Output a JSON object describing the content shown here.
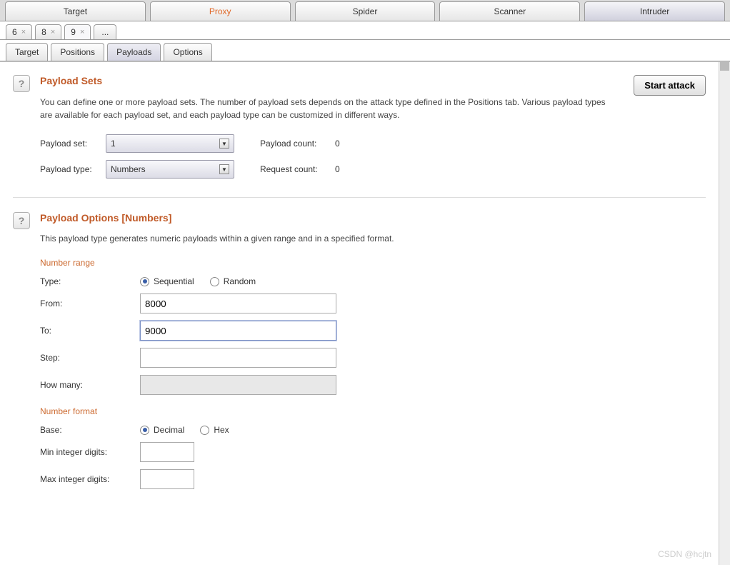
{
  "topTabs": {
    "target": "Target",
    "proxy": "Proxy",
    "spider": "Spider",
    "scanner": "Scanner",
    "intruder": "Intruder"
  },
  "numTabs": {
    "t6": "6",
    "t8": "8",
    "t9": "9",
    "ell": "..."
  },
  "subTabs": {
    "target": "Target",
    "positions": "Positions",
    "payloads": "Payloads",
    "options": "Options"
  },
  "startBtn": "Start attack",
  "payloadSets": {
    "title": "Payload Sets",
    "desc": "You can define one or more payload sets. The number of payload sets depends on the attack type defined in the Positions tab. Various payload types are available for each payload set, and each payload type can be customized in different ways.",
    "setLabel": "Payload set:",
    "setValue": "1",
    "typeLabel": "Payload type:",
    "typeValue": "Numbers",
    "countLabel": "Payload count:",
    "countValue": "0",
    "reqLabel": "Request count:",
    "reqValue": "0"
  },
  "payloadOptions": {
    "title": "Payload Options [Numbers]",
    "desc": "This payload type generates numeric payloads within a given range and in a specified format.",
    "rangeHead": "Number range",
    "typeLabel": "Type:",
    "seq": "Sequential",
    "rand": "Random",
    "fromLabel": "From:",
    "fromValue": "8000",
    "toLabel": "To:",
    "toValue": "9000",
    "stepLabel": "Step:",
    "stepValue": "",
    "howManyLabel": "How many:",
    "howManyValue": "",
    "formatHead": "Number format",
    "baseLabel": "Base:",
    "dec": "Decimal",
    "hex": "Hex",
    "minIntLabel": "Min integer digits:",
    "minIntValue": "",
    "maxIntLabel": "Max integer digits:",
    "maxIntValue": ""
  },
  "watermark": "CSDN @hcjtn"
}
